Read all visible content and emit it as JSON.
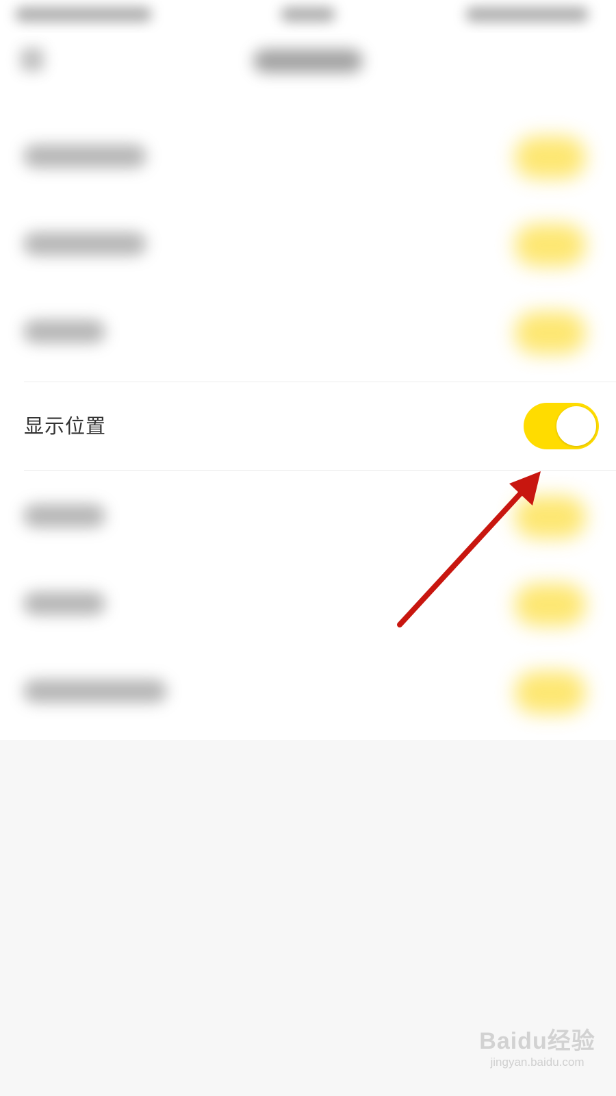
{
  "settings": {
    "visible_item": {
      "label": "显示位置",
      "toggle_on": true
    }
  },
  "colors": {
    "toggle_on": "#ffdc00",
    "annotation_arrow": "#c8160f",
    "label_text": "#333333"
  },
  "watermark": {
    "brand": "Baidu经验",
    "url": "jingyan.baidu.com"
  }
}
